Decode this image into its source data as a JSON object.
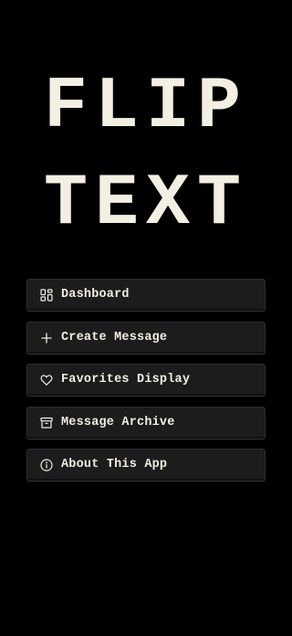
{
  "app": {
    "title_line_1": "FLIP",
    "title_line_2": "TEXT"
  },
  "theme": {
    "background": "#000000",
    "title_color": "#f3efe3",
    "button_background": "#1c1c1c",
    "text_color": "#f1ede2"
  },
  "menu": {
    "items": [
      {
        "label": "Dashboard",
        "icon": "dashboard-grid-icon"
      },
      {
        "label": "Create Message",
        "icon": "plus-icon"
      },
      {
        "label": "Favorites Display",
        "icon": "heart-icon"
      },
      {
        "label": "Message Archive",
        "icon": "archive-box-icon"
      },
      {
        "label": "About This App",
        "icon": "info-circle-icon"
      }
    ]
  }
}
